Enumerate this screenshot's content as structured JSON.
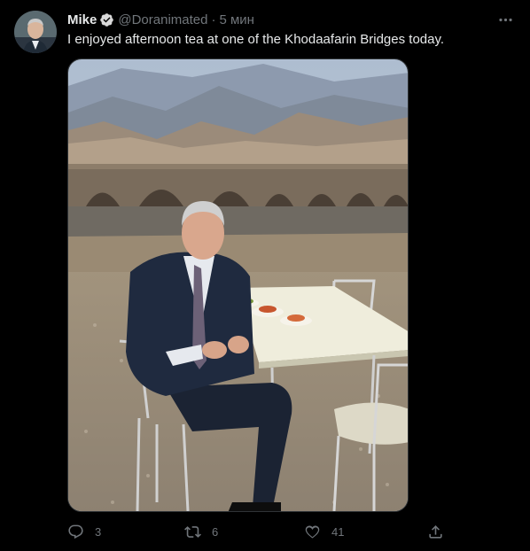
{
  "author": {
    "name": "Mike",
    "handle": "@Doranimated",
    "separator": "·",
    "time": "5 мин",
    "verified": true
  },
  "tweet": {
    "text": "I enjoyed afternoon tea at one of the Khodaafarin Bridges today."
  },
  "media": {
    "description_icon": "photo"
  },
  "actions": {
    "reply_count": "3",
    "retweet_count": "6",
    "like_count": "41"
  },
  "colors": {
    "background": "#000000",
    "text": "#e7e9ea",
    "muted": "#71767b",
    "verified_badge": "#d9d9d9"
  },
  "icons": [
    "more-icon",
    "verified-icon",
    "reply-icon",
    "retweet-icon",
    "like-icon",
    "share-icon"
  ]
}
